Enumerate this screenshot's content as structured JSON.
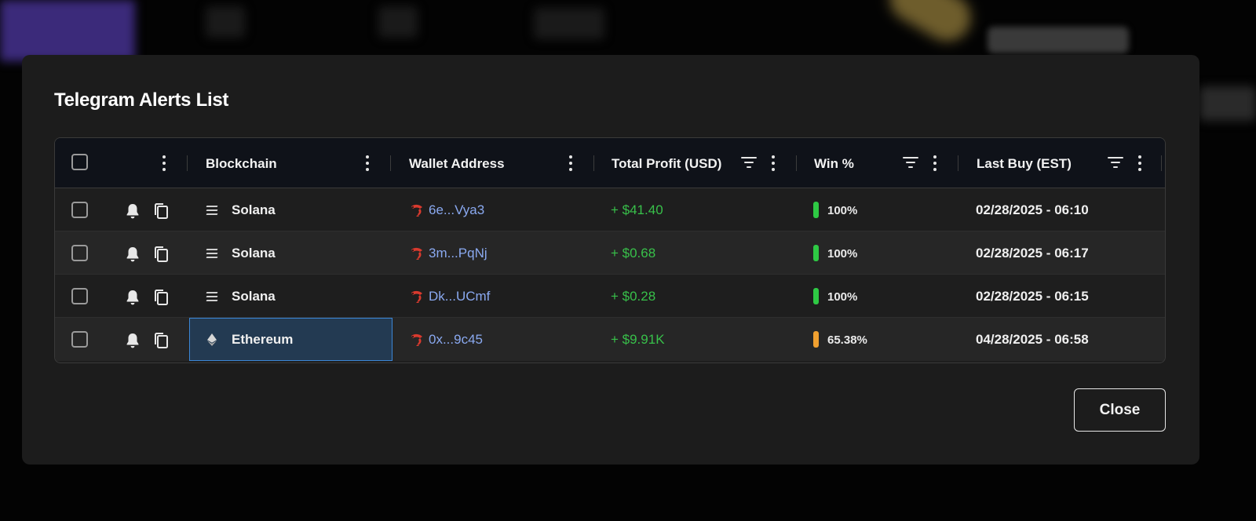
{
  "modal": {
    "title": "Telegram Alerts List",
    "close_label": "Close"
  },
  "table": {
    "columns": {
      "blockchain": "Blockchain",
      "wallet": "Wallet Address",
      "profit": "Total Profit (USD)",
      "win": "Win %",
      "lastbuy": "Last Buy (EST)"
    },
    "rows": [
      {
        "chain": "Solana",
        "chain_icon": "solana-icon",
        "wallet": "6e...Vya3",
        "profit": "+ $41.40",
        "win": "100%",
        "win_color": "#2ec944",
        "lastbuy": "02/28/2025 - 06:10"
      },
      {
        "chain": "Solana",
        "chain_icon": "solana-icon",
        "wallet": "3m...PqNj",
        "profit": "+ $0.68",
        "win": "100%",
        "win_color": "#2ec944",
        "lastbuy": "02/28/2025 - 06:17"
      },
      {
        "chain": "Solana",
        "chain_icon": "solana-icon",
        "wallet": "Dk...UCmf",
        "profit": "+ $0.28",
        "win": "100%",
        "win_color": "#2ec944",
        "lastbuy": "02/28/2025 - 06:15"
      },
      {
        "chain": "Ethereum",
        "chain_icon": "ethereum-icon",
        "wallet": "0x...9c45",
        "profit": "+ $9.91K",
        "win": "65.38%",
        "win_color": "#f0a030",
        "lastbuy": "04/28/2025 - 06:58"
      }
    ]
  },
  "colors": {
    "profit_green": "#38c04a",
    "wallet_blue": "#8aa9f0",
    "selection_border": "#3b86d6"
  }
}
